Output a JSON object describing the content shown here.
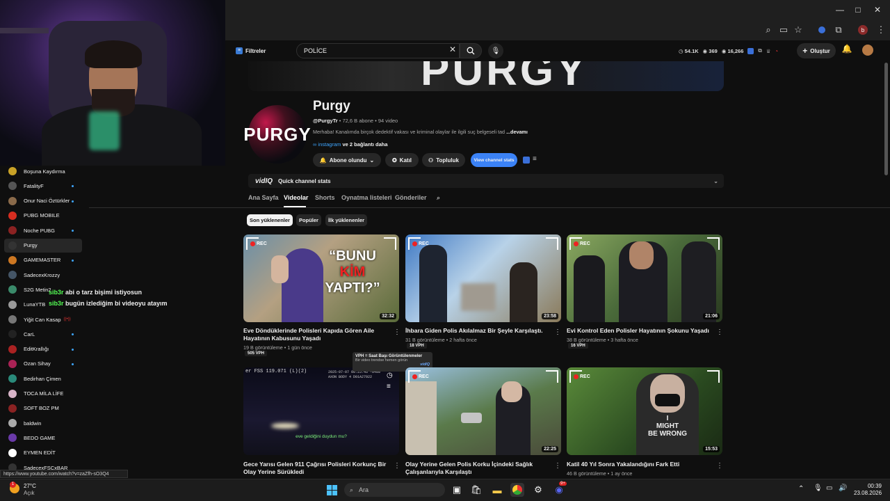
{
  "window": {
    "minimize": "—",
    "maximize": "□",
    "close": "✕"
  },
  "browser_icons": [
    "zoom-icon",
    "screen-cast-icon",
    "star-icon",
    "extension-icon",
    "puzzle-icon",
    "profile-icon",
    "menu-icon"
  ],
  "profile_letter": "b",
  "yt_header": {
    "filters_label": "Filtreler",
    "search_value": "POLİCE",
    "stats": [
      "54.1K",
      "369",
      "16,266"
    ],
    "create_label": "Oluştur"
  },
  "sidebar": {
    "items": [
      {
        "label": "Boşuna Kaydırma",
        "color": "#c9a227",
        "dot": false
      },
      {
        "label": "FatalityF",
        "color": "#555555",
        "dot": true
      },
      {
        "label": "Onur Naci Öztürkler",
        "color": "#8a6a4a",
        "dot": true
      },
      {
        "label": "PUBG MOBILE",
        "color": "#d62d20",
        "dot": false
      },
      {
        "label": "Noche PUBG",
        "color": "#8b2222",
        "dot": true
      },
      {
        "label": "Purgy",
        "color": "#333333",
        "dot": false
      },
      {
        "label": "GAMEMASTER",
        "color": "#cc7722",
        "dot": true
      },
      {
        "label": "SadecexKrozzy",
        "color": "#445566",
        "dot": false
      },
      {
        "label": "S2G Metin2",
        "color": "#3a8a6a",
        "dot": false
      },
      {
        "label": "LunaYTB",
        "color": "#9a9a9a",
        "dot": false
      },
      {
        "label": "Yiğit Can Kasap",
        "color": "#777777",
        "dot": false
      },
      {
        "label": "CarL",
        "color": "#222222",
        "dot": true
      },
      {
        "label": "EditKrallığı",
        "color": "#aa2222",
        "dot": true
      },
      {
        "label": "Ozan Sihay",
        "color": "#aa2255",
        "dot": true
      },
      {
        "label": "Bedirhan Çimen",
        "color": "#2a8a7a",
        "dot": false
      },
      {
        "label": "TOCA MİLA LİFE",
        "color": "#d8b4c8",
        "dot": false
      },
      {
        "label": "SOFT BOZ PM",
        "color": "#8a2222",
        "dot": false
      },
      {
        "label": "baldwin",
        "color": "#aaaaaa",
        "dot": false
      },
      {
        "label": "BEDO GAME",
        "color": "#6a3aa8",
        "dot": false
      },
      {
        "label": "EYMEN EDİT",
        "color": "#ffffff",
        "dot": false
      },
      {
        "label": "SadecexFSCxBAR",
        "color": "#333333",
        "dot": false
      }
    ],
    "live_badge": "((•))"
  },
  "chat": [
    {
      "user": "sib3r",
      "message": "abi o tarz bişimi istiyosun"
    },
    {
      "user": "sib3r",
      "message": "bugün izlediğim bi videoyu atayım"
    }
  ],
  "channel": {
    "banner_text": "PURGY",
    "avatar_text": "PURGY",
    "name": "Purgy",
    "handle": "@PurgyTr",
    "meta": " • 72,6 B abone • 94 video",
    "description": "Merhaba! Kanalımda birçok dedektif vakası ve kriminal olaylar ile ilgili suç belgeseli tad",
    "more": "...devamı",
    "link": "∞ instagram",
    "link_more": "ve 2 bağlantı daha",
    "subscribed_label": "Abone olundu",
    "join_label": "Katıl",
    "community_label": "Topluluk",
    "stats_label": "View channel stats",
    "quick_stats": "Quick channel stats",
    "vidiq": "vidIQ"
  },
  "tabs": [
    "Ana Sayfa",
    "Videolar",
    "Shorts",
    "Oynatma listeleri",
    "Gönderiler"
  ],
  "chips": [
    "Son yüklenenler",
    "Popüler",
    "İlk yüklenenler"
  ],
  "videos": [
    {
      "title": "Eve Döndüklerinde Polisleri Kapıda Gören Aile Hayatının Kabusunu Yaşadı",
      "views": "19 B görüntüleme",
      "age": "1 gün önce",
      "duration": "32:32",
      "vph": "505 VPH",
      "overlay": [
        "“BUNU",
        "KİM",
        "YAPTI?”"
      ],
      "rec": "REC"
    },
    {
      "title": "İhbara Giden Polis Akılalmaz Bir Şeyle Karşılaştı.",
      "views": "31 B görüntüleme",
      "age": "2 hafta önce",
      "duration": "23:58",
      "vph": "18 VPH",
      "rec": "REC"
    },
    {
      "title": "Evi Kontrol Eden Polisler Hayatının Şokunu Yaşadı",
      "views": "38 B görüntüleme",
      "age": "3 hafta önce",
      "duration": "21:06",
      "vph": "16 VPH",
      "rec": "REC"
    },
    {
      "title": "Gece Yarısı Gelen 911 Çağrısı Polisleri Korkunç Bir Olay Yerine Sürükledi",
      "views": "",
      "age": "",
      "duration": "",
      "vph": "",
      "hud": "er FSS 119.071 (L)(2)",
      "hud2": "2025-07-07 00:25:46 -0400",
      "hud3": "AXON BODY 4 D01A27922",
      "subtitle": "eve geldiğini duydun mu?",
      "rec": ""
    },
    {
      "title": "Olay Yerine Gelen Polis Korku İçindeki Sağlık Çalışanlarıyla Karşılaştı",
      "views": "",
      "age": "",
      "duration": "22:25",
      "vph": "",
      "rec": "REC"
    },
    {
      "title": "Katil 40 Yıl Sonra Yakalandığını Fark Etti",
      "views": "46 B görüntüleme",
      "age": "1 ay önce",
      "duration": "15:53",
      "vph": "",
      "overlay2": [
        "I",
        "MIGHT",
        "BE WRONG"
      ],
      "rec": "REC"
    }
  ],
  "tooltip": {
    "title": "VPH = Saat Başı Görüntülenmeler",
    "body": "Bir video trendse hemen görün",
    "brand": "vidIQ"
  },
  "status_url": "https://www.youtube.com/watch?v=zaZfh-sO3Q4",
  "taskbar": {
    "weather_temp": "27°C",
    "weather_desc": "Açık",
    "search_placeholder": "Ara",
    "time": "00:39",
    "date": "23.08.2026",
    "badge": "1",
    "discord_badge": "9+"
  }
}
